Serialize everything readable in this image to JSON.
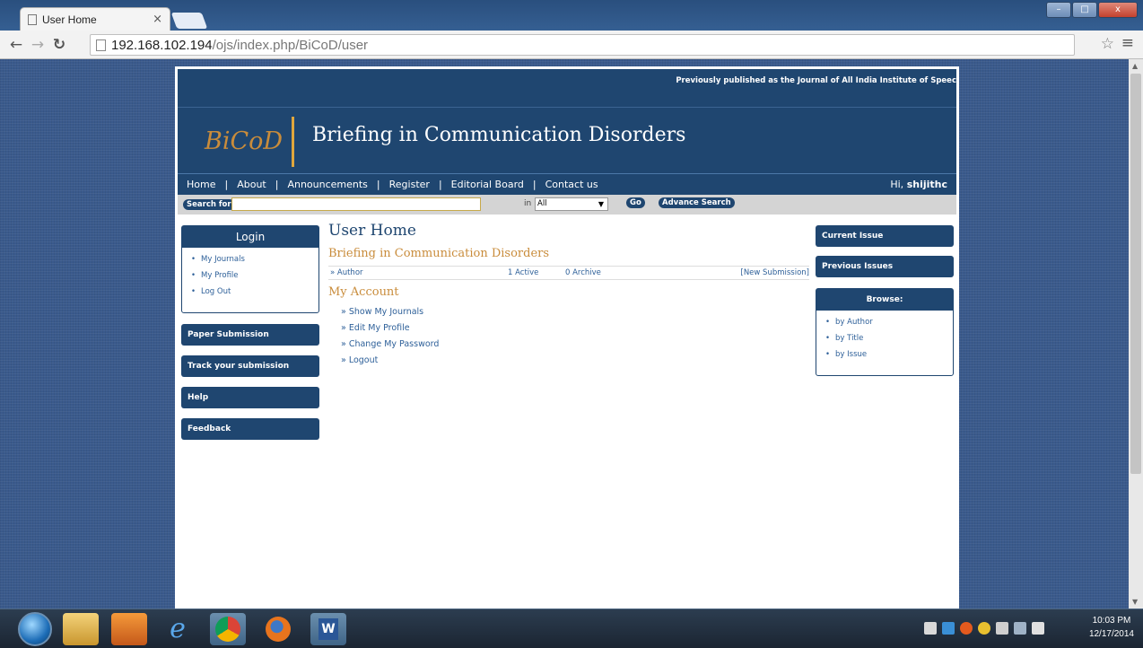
{
  "browser": {
    "tab_title": "User Home",
    "tab_close": "×",
    "url_host": "192.168.102.194",
    "url_path": "/ojs/index.php/BiCoD/user",
    "window_buttons": [
      "–",
      "□",
      "x"
    ]
  },
  "site": {
    "top_note": "Previously published as the Journal of All India Institute of Speec",
    "logo": "BiCoD",
    "title": "Briefing in Communication Disorders",
    "nav": [
      "Home",
      "About",
      "Announcements",
      "Register",
      "Editorial Board",
      "Contact us"
    ],
    "nav_separator": "|",
    "greeting_prefix": "Hi,",
    "username": "shijithc"
  },
  "search": {
    "label": "Search  for",
    "value": "",
    "in_label": "in",
    "scope": "All",
    "go_label": "Go",
    "advanced_label": "Advance Search"
  },
  "left_sidebar": {
    "login_title": "Login",
    "login_links": [
      "My Journals",
      "My Profile",
      "Log Out"
    ],
    "buttons": [
      "Paper Submission",
      "Track your submission",
      "Help",
      "Feedback"
    ]
  },
  "main": {
    "heading": "User Home",
    "journal_title": "Briefing in Communication Disorders",
    "role": "» Author",
    "active": "1 Active",
    "archive": "0 Archive",
    "new_submission": "[New Submission]",
    "account_heading": "My Account",
    "account_links": [
      "» Show My Journals",
      "» Edit My Profile",
      "» Change My Password",
      "» Logout"
    ]
  },
  "right_sidebar": {
    "current_issue": "Current Issue",
    "previous_issues": "Previous Issues",
    "browse_title": "Browse:",
    "browse_links": [
      "by Author",
      "by Title",
      "by Issue"
    ]
  },
  "taskbar": {
    "time": "10:03 PM",
    "date": "12/17/2014"
  },
  "colors": {
    "brand_navy": "#1f4670",
    "brand_gold": "#c98c3b",
    "link_blue": "#2e6099"
  }
}
